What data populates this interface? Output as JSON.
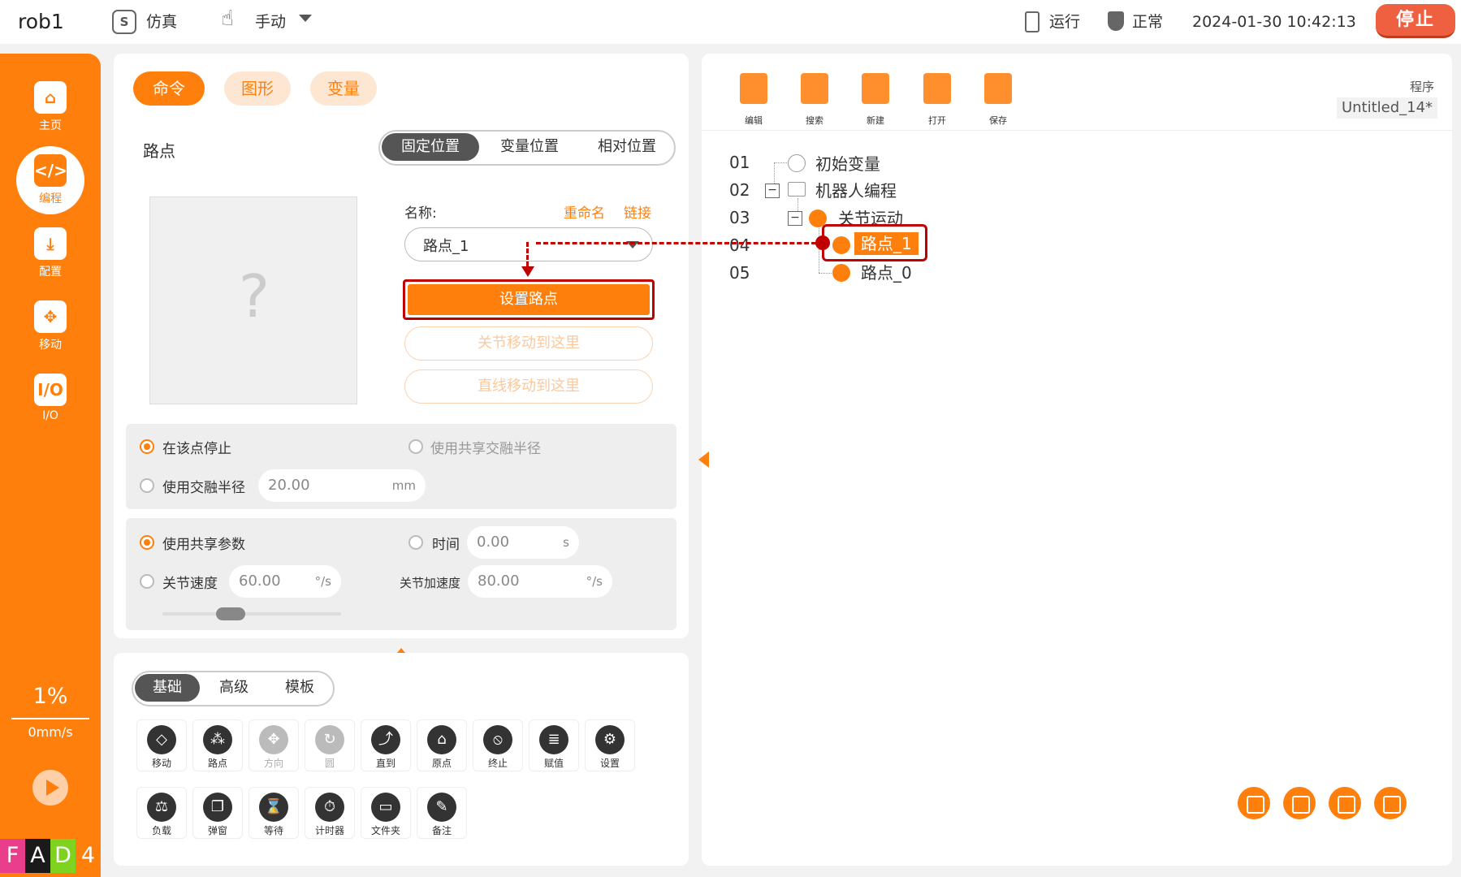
{
  "topbar": {
    "robot_name": "rob1",
    "sim_icon": "S",
    "sim_label": "仿真",
    "mode_label": "手动",
    "run_label": "运行",
    "status_label": "正常",
    "datetime": "2024-01-30 10:42:13",
    "stop_label": "停止"
  },
  "rail": {
    "items": [
      {
        "icon": "home-icon",
        "label": "主页"
      },
      {
        "icon": "code-icon",
        "label": "编程"
      },
      {
        "icon": "download-icon",
        "label": "配置"
      },
      {
        "icon": "move-icon",
        "label": "移动"
      },
      {
        "icon": "io-icon",
        "label": "I/O",
        "glyph": "I/O"
      }
    ],
    "code_glyph": "</>",
    "speed_percent": "1%",
    "speed_value": "0mm/s",
    "brand_letters": [
      "F",
      "A",
      "D",
      "4"
    ],
    "brand_colors": [
      "#e83e8c",
      "#1a1a1a",
      "#7fd320",
      "#ff7f0c"
    ]
  },
  "left": {
    "tabs": [
      "命令",
      "图形",
      "变量"
    ],
    "section_title": "路点",
    "position_tabs": [
      "固定位置",
      "变量位置",
      "相对位置"
    ],
    "preview_glyph": "?",
    "name_label": "名称:",
    "rename_link": "重命名",
    "link_link": "链接",
    "name_value": "路点_1",
    "set_point_button": "设置路点",
    "joint_move_button": "关节移动到这里",
    "linear_move_button": "直线移动到这里",
    "stop_here": "在该点停止",
    "shared_blend": "使用共享交融半径",
    "use_blend": "使用交融半径",
    "blend_value": "20.00",
    "blend_unit": "mm",
    "shared_params": "使用共享参数",
    "time_label": "时间",
    "time_value": "0.00",
    "time_unit": "s",
    "joint_speed_label": "关节速度",
    "joint_speed_value": "60.00",
    "joint_speed_unit": "°/s",
    "joint_accel_label": "关节加速度",
    "joint_accel_value": "80.00",
    "joint_accel_unit": "°/s"
  },
  "toolbox": {
    "tabs": [
      "基础",
      "高级",
      "模板"
    ],
    "tools": [
      {
        "label": "移动",
        "glyph": "◇"
      },
      {
        "label": "路点",
        "glyph": "⁂"
      },
      {
        "label": "方向",
        "glyph": "✥"
      },
      {
        "label": "圆",
        "glyph": "↻"
      },
      {
        "label": "直到",
        "glyph": "⤴"
      },
      {
        "label": "原点",
        "glyph": "⌂"
      },
      {
        "label": "终止",
        "glyph": "⦸"
      },
      {
        "label": "赋值",
        "glyph": "≣"
      },
      {
        "label": "设置",
        "glyph": "⚙"
      },
      {
        "label": "负载",
        "glyph": "⚖"
      },
      {
        "label": "弹窗",
        "glyph": "❐"
      },
      {
        "label": "等待",
        "glyph": "⌛"
      },
      {
        "label": "计时器",
        "glyph": "⏱"
      },
      {
        "label": "文件夹",
        "glyph": "▭"
      },
      {
        "label": "备注",
        "glyph": "✎"
      }
    ]
  },
  "right": {
    "toolbar": [
      "编辑",
      "搜索",
      "新建",
      "打开",
      "保存"
    ],
    "program_label": "程序",
    "program_name": "Untitled_14*",
    "lines": [
      "01",
      "02",
      "03",
      "04",
      "05"
    ],
    "tree": [
      "初始变量",
      "机器人编程",
      "关节运动",
      "路点_1",
      "路点_0"
    ],
    "tree_expander": "−"
  },
  "colors": {
    "accent": "#ff7f0c",
    "annotation": "#c00000"
  }
}
